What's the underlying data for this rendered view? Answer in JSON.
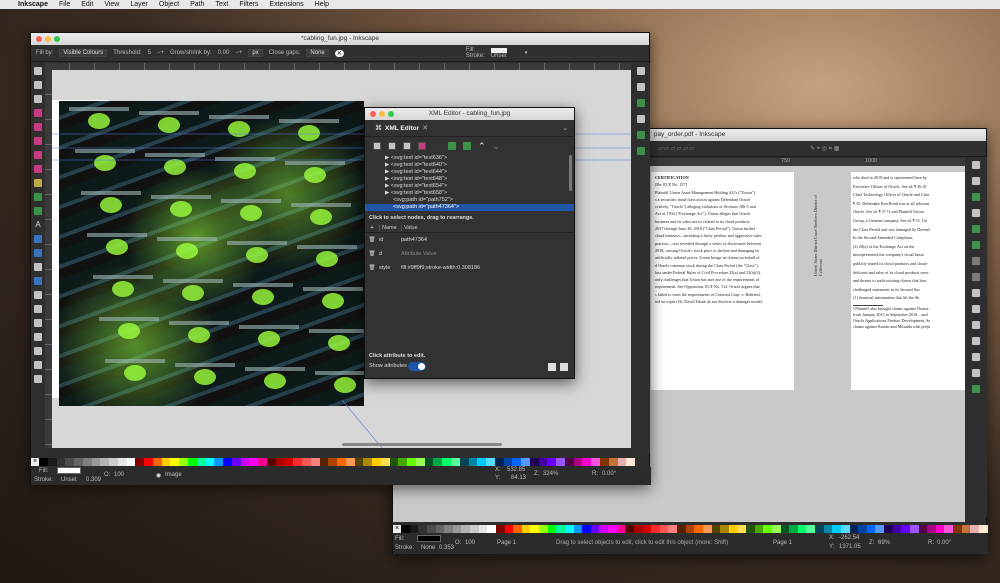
{
  "menubar": {
    "apple": "",
    "items": [
      "Inkscape",
      "File",
      "Edit",
      "View",
      "Layer",
      "Object",
      "Path",
      "Text",
      "Filters",
      "Extensions",
      "Help"
    ]
  },
  "win1": {
    "title": "*cabling_fun.jpg - Inkscape",
    "toolbar": {
      "fill_by_label": "Fill by:",
      "fill_by_value": "Visible Colours",
      "threshold_label": "Threshold:",
      "threshold_value": "5",
      "grow_label": "Grow/shrink by:",
      "grow_value": "0.00",
      "unit": "px",
      "close_gaps_label": "Close gaps:",
      "close_gaps_value": "None",
      "fill_label": "Fill:",
      "stroke_label": "Stroke:",
      "stroke_value": "Unset"
    },
    "status": {
      "fill_label": "Fill:",
      "stroke_label": "Stroke:",
      "stroke_value": "Unset",
      "stroke_width": "0.309",
      "opacity_label": "O:",
      "opacity_value": "100",
      "layer": "Image",
      "x_label": "X:",
      "x_value": "532.85",
      "y_label": "Y:",
      "y_value": "84.13",
      "zoom_label": "Z:",
      "zoom_value": "324%",
      "rot_label": "R:",
      "rot_value": "0.00°"
    }
  },
  "xml": {
    "title": "XML Editor - cabling_fun.jpg",
    "tab": "XML Editor",
    "nodes": [
      "<svg:text id=\"text636\">",
      "<svg:text id=\"text640\">",
      "<svg:text id=\"text644\">",
      "<svg:text id=\"text648\">",
      "<svg:text id=\"text654\">",
      "<svg:text id=\"text658\">",
      "<svg:path id=\"path752\">",
      "<svg:path id=\"path47364\">"
    ],
    "hint_nodes": "Click to select nodes, drag to rearrange.",
    "col_name": "Name",
    "col_value": "Value",
    "attrs": [
      {
        "name": "id",
        "value": "path47364"
      },
      {
        "name": "d",
        "value": "Attribute Value"
      },
      {
        "name": "style",
        "value": "fill:#9ff9f9;stroke-width:0.308186"
      }
    ],
    "hint_attr": "Click attribute to edit.",
    "show_attrs": "Show attributes"
  },
  "win2": {
    "title": "pay_order.pdf - Inkscape",
    "ruler": [
      "750",
      "1000"
    ],
    "doc_left_heading": "CERTIFICATION",
    "doc_left_sub": "[Re: ECF No. 157]",
    "doc_left": [
      "Plaintiff Union Asset Management Holding AG's (\"Union\")",
      "s a securities fraud class action against Defendant Oracle",
      "ectively, \"Oracle\") alleging violations of Sections 10b-5 and",
      "Act of 1934 (\"Exchange Act\"). Union alleges that Oracle",
      "business and its sales tactics related to its cloud products",
      "2017 through June 20, 2018 (\"Class Period\"). Union further",
      "cloud business—including a fruity product and aggressive sales",
      "practice—was revealed through a series of disclosures between",
      "2018, causing Oracle's stock price to decline and damaging its",
      "artificially inflated prices. Union brings its claims on behalf of",
      "d Oracle common stock during the Class Period (the \"Class\").",
      "lass under Federal Rules of Civil Procedure 23(a) and 23(b)(3).",
      "only challenges that Union has met one of the requirements of",
      "requirement. See Opposition, ECF No. 112. Oracle argues that",
      "s failed to meet the requirements of Comcast Corp. v. Behrend,",
      "ied on expert Dr. David Tabak do not disclose a damages model."
    ],
    "doc_side": [
      "United States District Court",
      "Northern District of California"
    ],
    "doc_right": [
      "who died in 2019 and is represented here by",
      "Executive Officer of Oracle. See id. ¶ 36. D",
      "Chief Technology Officer of Oracle and Chai",
      "¶ 35. Defendant Ken Bond was at all relevant",
      "Oracle. See id. ¶ 37.¹ Lead Plaintiff Union",
      "Group, a German company. See id. ¶ 31. Un",
      "the Class Period and was damaged by Defend",
      "In the Second Amended Complaint,",
      "(2) 20(a) of the Exchange Act on the",
      "misrepresented the company's cloud busin",
      "publicly touted its cloud products and cloud-",
      "deficient and sales of its cloud products were",
      "and threats to audit existing clients that bou",
      "challenged statements in its Second Am",
      "(1) financial information that lift the Sh"
    ],
    "footnote": [
      "¹ Plaintiff also brought claims against Thoma",
      "from January 2015 to September 2018 – and",
      "Oracle Applications Product Development. Se",
      "claims against Kurian and Miranda with preju"
    ],
    "status": {
      "fill_label": "Fill:",
      "stroke_label": "Stroke:",
      "stroke_value": "None",
      "stroke_width": "0.353",
      "opacity_label": "O:",
      "opacity_value": "100",
      "page": "Page 1",
      "message": "Drag to select objects to edit, click to edit this object (more: Shift)",
      "page2": "Page 1",
      "x_label": "X:",
      "x_value": "-262.54",
      "y_label": "Y:",
      "y_value": "1371.05",
      "zoom_label": "Z:",
      "zoom_value": "69%",
      "rot_label": "R:",
      "rot_value": "0.00°"
    }
  },
  "colors": {
    "accent": "#1f56a8",
    "led_green": "#9cff3c",
    "window_bg": "#2e2e2e"
  }
}
